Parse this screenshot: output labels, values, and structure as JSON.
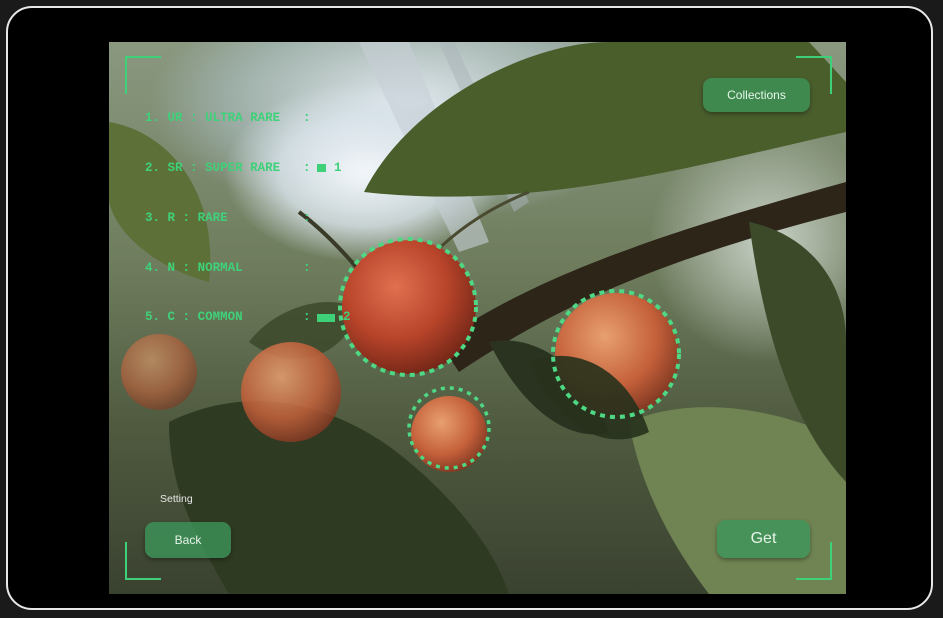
{
  "rarity_list": [
    {
      "index": "1.",
      "code": "UR",
      "name": "ULTRA RARE",
      "count": ""
    },
    {
      "index": "2.",
      "code": "SR",
      "name": "SUPER RARE",
      "count": "1"
    },
    {
      "index": "3.",
      "code": "R",
      "name": "RARE",
      "count": ""
    },
    {
      "index": "4.",
      "code": "N",
      "name": "NORMAL",
      "count": ""
    },
    {
      "index": "5.",
      "code": "C",
      "name": "COMMON",
      "count": "2"
    }
  ],
  "buttons": {
    "collections_label": "Collections",
    "back_label": "Back",
    "get_label": "Get",
    "setting_label": "Setting"
  },
  "detected_targets": [
    "cherry",
    "cherry",
    "cherry"
  ],
  "colors": {
    "accent": "#3fd17a",
    "button_bg": "#3c965a",
    "cherry": "#c4502a"
  },
  "icons": [
    "corner-bracket-icon"
  ]
}
